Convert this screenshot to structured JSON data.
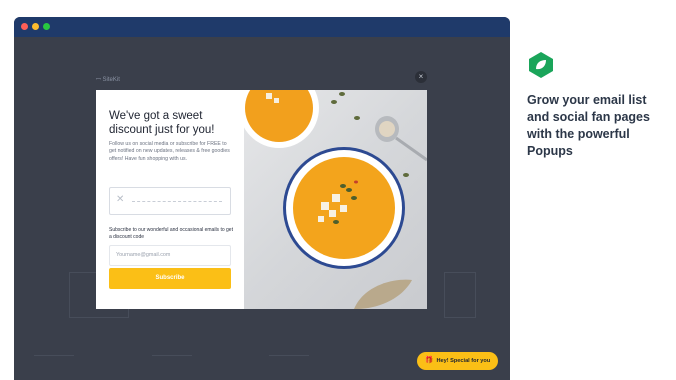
{
  "window": {
    "site_logo": "ꟷ SiteKit"
  },
  "popup": {
    "close_icon": "×",
    "headline": "We've got a sweet discount just for you!",
    "body": "Follow us on social media or subscribe for FREE to get notified on new updates, releases & free goodies offers! Have fun shopping with us.",
    "coupon_icon": "✕",
    "subscribe_prompt": "Subscribe to our wonderful and occasional emails to get a discount code",
    "email_placeholder": "Yourname@gmail.com",
    "subscribe_label": "Subscribe"
  },
  "promo": {
    "text": "Grow your email list and social fan pages with the powerful Popups"
  },
  "special_button": {
    "label": "Hey! Special for you"
  },
  "colors": {
    "accent": "#fbbf16",
    "brand": "#1aa55a",
    "window_bg": "#3a3f4b",
    "titlebar": "#1f3a6a"
  }
}
